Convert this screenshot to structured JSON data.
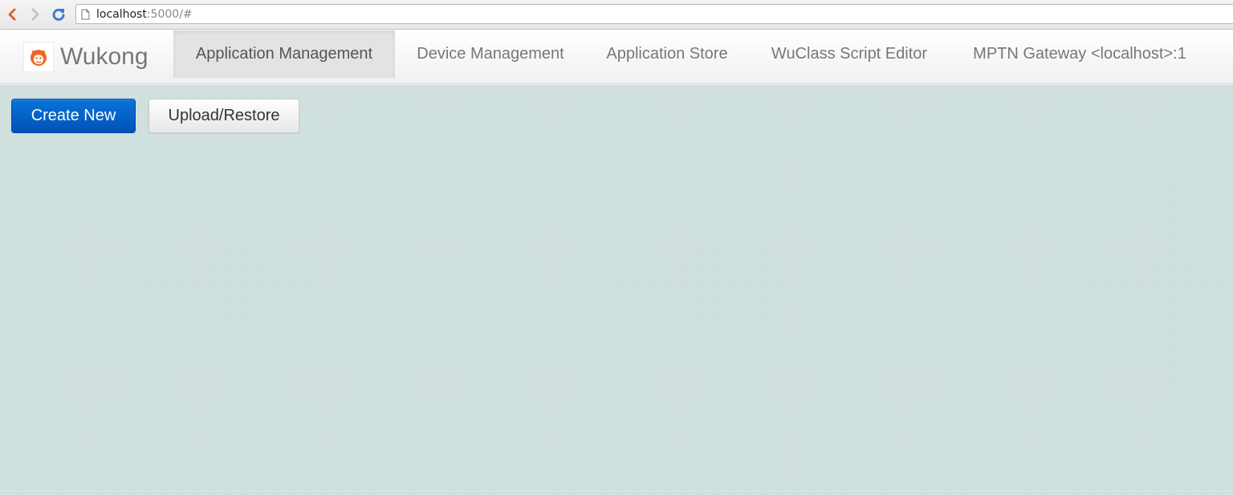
{
  "browser": {
    "url_host": "localhost",
    "url_path": ":5000/#",
    "icons": {
      "back": "chevron-left-icon",
      "forward": "chevron-right-icon",
      "reload": "reload-icon",
      "page": "page-icon"
    }
  },
  "navbar": {
    "brand": "Wukong",
    "brand_icon": "monkey-logo-icon",
    "items": [
      {
        "label": "Application Management",
        "active": true
      },
      {
        "label": "Device Management",
        "active": false
      },
      {
        "label": "Application Store",
        "active": false
      },
      {
        "label": "WuClass Script Editor",
        "active": false
      },
      {
        "label": "MPTN Gateway <localhost>:1",
        "active": false
      }
    ]
  },
  "actions": {
    "create_new": "Create New",
    "upload_restore": "Upload/Restore"
  },
  "colors": {
    "primary": "#0a6fd6",
    "background": "#cfe0df",
    "accent_orange": "#f26522"
  }
}
